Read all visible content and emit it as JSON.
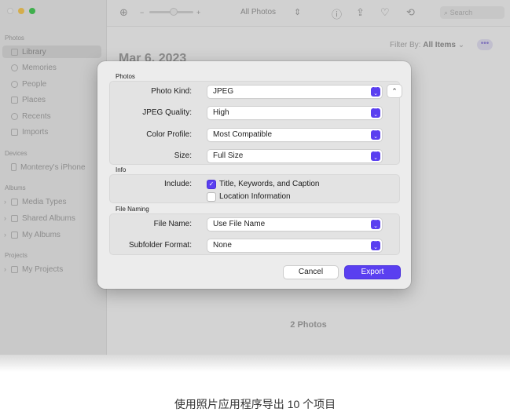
{
  "sidebar": {
    "sections": {
      "photos": "Photos",
      "devices": "Devices",
      "albums": "Albums",
      "projects": "Projects"
    },
    "items": [
      {
        "label": "Library",
        "icon": "library-icon"
      },
      {
        "label": "Memories",
        "icon": "memories-icon"
      },
      {
        "label": "People",
        "icon": "people-icon"
      },
      {
        "label": "Places",
        "icon": "places-icon"
      },
      {
        "label": "Recents",
        "icon": "recents-icon"
      },
      {
        "label": "Imports",
        "icon": "imports-icon"
      }
    ],
    "device": "Monterey's iPhone",
    "albums": [
      "Media Types",
      "Shared Albums",
      "My Albums"
    ],
    "projects": [
      "My Projects"
    ]
  },
  "toolbar": {
    "title": "All Photos",
    "search_placeholder": "Search"
  },
  "content": {
    "filter_label": "Filter By:",
    "filter_value": "All Items",
    "more_glyph": "•••",
    "date_heading": "Mar 6, 2023",
    "photo_count": "2 Photos"
  },
  "dialog": {
    "photos_section": "Photos",
    "photo_kind_label": "Photo Kind:",
    "photo_kind_value": "JPEG",
    "jpeg_quality_label": "JPEG Quality:",
    "jpeg_quality_value": "High",
    "color_profile_label": "Color Profile:",
    "color_profile_value": "Most Compatible",
    "size_label": "Size:",
    "size_value": "Full Size",
    "info_section": "Info",
    "include_label": "Include:",
    "include_title": "Title, Keywords, and Caption",
    "include_title_checked": true,
    "include_location": "Location Information",
    "include_location_checked": false,
    "file_naming_section": "File Naming",
    "file_name_label": "File Name:",
    "file_name_value": "Use File Name",
    "subfolder_label": "Subfolder Format:",
    "subfolder_value": "None",
    "cancel_label": "Cancel",
    "export_label": "Export"
  },
  "caption": "使用照片应用程序导出 10 个项目",
  "colors": {
    "accent": "#5a3ff0",
    "dialog_bg": "#ececec",
    "group_bg": "#e3e3e3"
  }
}
